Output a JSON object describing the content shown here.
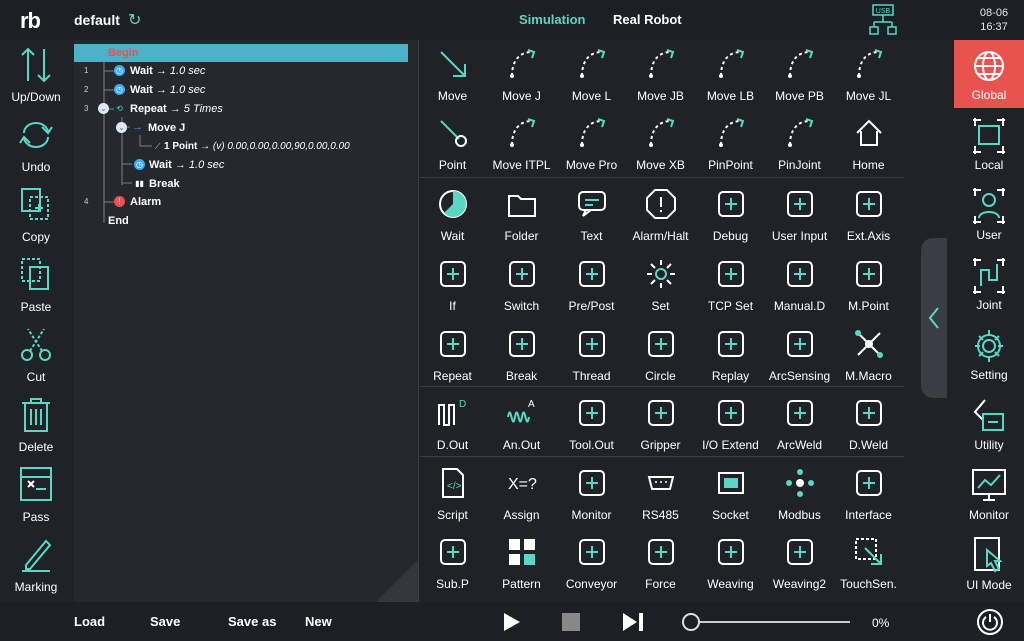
{
  "header": {
    "logo": "rb",
    "project": "default",
    "modes": [
      "Simulation",
      "Real Robot"
    ],
    "usb": "USB",
    "date": "08-06",
    "time": "16:37"
  },
  "left_toolbar": [
    "Up/Down",
    "Undo",
    "Copy",
    "Paste",
    "Cut",
    "Delete",
    "Pass",
    "Marking"
  ],
  "tree": {
    "begin": "Begin",
    "end": "End",
    "rows": [
      {
        "num": "1",
        "name": "Wait",
        "detail": "→ 1.0 sec"
      },
      {
        "num": "2",
        "name": "Wait",
        "detail": "→ 1.0 sec"
      },
      {
        "num": "3",
        "name": "Repeat",
        "detail": "→ 5 Times"
      },
      {
        "num": "",
        "name": "Move J",
        "detail": ""
      },
      {
        "num": "",
        "name": "1 Point",
        "detail": "→ (v) 0.00,0.00,0.00,90,0.00,0.00"
      },
      {
        "num": "",
        "name": "Wait",
        "detail": "→ 1.0 sec"
      },
      {
        "num": "",
        "name": "Break",
        "detail": ""
      },
      {
        "num": "4",
        "name": "Alarm",
        "detail": ""
      }
    ]
  },
  "commands": [
    [
      "Move",
      "Move J",
      "Move L",
      "Move JB",
      "Move LB",
      "Move PB",
      "Move JL"
    ],
    [
      "Point",
      "Move ITPL",
      "Move Pro",
      "Move XB",
      "PinPoint",
      "PinJoint",
      "Home"
    ],
    [
      "Wait",
      "Folder",
      "Text",
      "Alarm/Halt",
      "Debug",
      "User Input",
      "Ext.Axis"
    ],
    [
      "If",
      "Switch",
      "Pre/Post",
      "Set",
      "TCP Set",
      "Manual.D",
      "M.Point"
    ],
    [
      "Repeat",
      "Break",
      "Thread",
      "Circle",
      "Replay",
      "ArcSensing",
      "M.Macro"
    ],
    [
      "D.Out",
      "An.Out",
      "Tool.Out",
      "Gripper",
      "I/O Extend",
      "ArcWeld",
      "D.Weld"
    ],
    [
      "Script",
      "Assign",
      "Monitor",
      "RS485",
      "Socket",
      "Modbus",
      "Interface"
    ],
    [
      "Sub.P",
      "Pattern",
      "Conveyor",
      "Force",
      "Weaving",
      "Weaving2",
      "TouchSen."
    ]
  ],
  "right_toolbar": [
    "Global",
    "Local",
    "User",
    "Joint",
    "Setting",
    "Utility",
    "Monitor",
    "UI Mode"
  ],
  "footer": {
    "buttons": [
      "Load",
      "Save",
      "Save as",
      "New"
    ],
    "progress": 0,
    "progress_label": "0%"
  },
  "colors": {
    "accent": "#5bd6c4",
    "active": "#e8524f",
    "tree_header": "#4fb1c8",
    "background": "#1f2227"
  }
}
